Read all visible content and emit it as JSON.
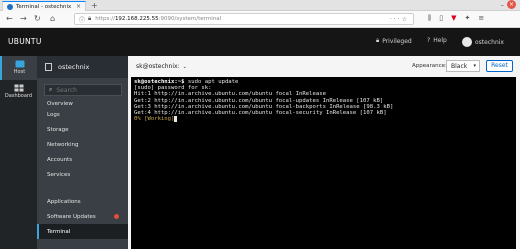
{
  "browser": {
    "tab_title": "Terminal - ostechnix",
    "tab_close": "×",
    "new_tab": "+",
    "url_host": "192.168.225.55",
    "url_rest": ":9090/system/terminal",
    "url_scheme": "https://",
    "win_min": "–",
    "win_close": "×"
  },
  "header": {
    "brand": "UBUNTU",
    "privileged": "Privileged",
    "help": "Help",
    "user": "ostechnix"
  },
  "rail": {
    "items": [
      {
        "label": "Host"
      },
      {
        "label": "Dashboard"
      }
    ]
  },
  "host": {
    "name": "ostechnix",
    "search_placeholder": "Search",
    "nav": [
      {
        "label": "Overview"
      },
      {
        "label": "Logs"
      },
      {
        "label": "Storage"
      },
      {
        "label": "Networking"
      },
      {
        "label": "Accounts"
      },
      {
        "label": "Services"
      },
      {
        "label": "Applications"
      },
      {
        "label": "Software Updates"
      },
      {
        "label": "Terminal"
      }
    ]
  },
  "terminal_header": {
    "host": "sk@ostechnix:",
    "appearance_label": "Appearance:",
    "appearance_value": "Black",
    "reset": "Reset"
  },
  "terminal": {
    "prompt": "sk@ostechnix:~$",
    "command": " sudo apt update",
    "lines": [
      "[sudo] password for sk:",
      "Hit:1 http://in.archive.ubuntu.com/ubuntu focal InRelease",
      "Get:2 http://in.archive.ubuntu.com/ubuntu focal-updates InRelease [107 kB]",
      "Get:3 http://in.archive.ubuntu.com/ubuntu focal-backports InRelease [98.3 kB]",
      "Get:4 http://in.archive.ubuntu.com/ubuntu focal-security InRelease [107 kB]"
    ],
    "progress": "0% [Working]"
  },
  "colors": {
    "accent": "#39a5dc",
    "header_bg": "#151515",
    "sidebar_bg": "#393f44",
    "alert": "#e34d3c",
    "link": "#0066cc"
  }
}
